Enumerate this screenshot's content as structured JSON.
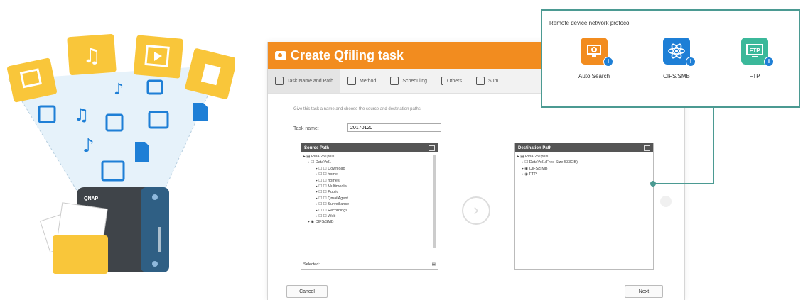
{
  "illustration": {
    "device_brand": "QNAP"
  },
  "window": {
    "title": "Create Qfiling task",
    "steps": [
      {
        "label": "Task Name and Path",
        "icon": "task-path-icon"
      },
      {
        "label": "Method",
        "icon": "method-icon"
      },
      {
        "label": "Scheduling",
        "icon": "calendar-icon"
      },
      {
        "label": "Others",
        "icon": "others-icon"
      },
      {
        "label": "Sum",
        "icon": "summary-icon"
      }
    ],
    "intro": "Give this task a name and choose the source and destination paths.",
    "task_name_label": "Task name:",
    "task_name_value": "20170120",
    "source": {
      "header": "Source Path",
      "items": [
        "Rina-251plus",
        "DataVol1",
        "Download",
        "home",
        "homes",
        "Multimedia",
        "Public",
        "QmailAgent",
        "Surveillance",
        "Recordings",
        "Web",
        "CIFS/SMB"
      ],
      "selected_label": "Selected:"
    },
    "destination": {
      "header": "Destination Path",
      "items": [
        "Rina-251plus",
        "DataVol1(Free Size:533GB)",
        "CIFS/SMB",
        "FTP"
      ]
    },
    "cancel_label": "Cancel",
    "next_label": "Next"
  },
  "popup": {
    "title": "Remote device network protocol",
    "protocols": [
      {
        "label": "Auto Search",
        "icon": "auto-search-icon",
        "color": "#f28c1f"
      },
      {
        "label": "CIFS/SMB",
        "icon": "cifs-smb-icon",
        "color": "#1e7fd6"
      },
      {
        "label": "FTP",
        "icon": "ftp-icon",
        "color": "#3bb89a"
      }
    ],
    "info_glyph": "i"
  },
  "colors": {
    "accent": "#f28c1f",
    "connector": "#4b9a92",
    "folder": "#f9c63a",
    "file": "#1e7fd6"
  }
}
